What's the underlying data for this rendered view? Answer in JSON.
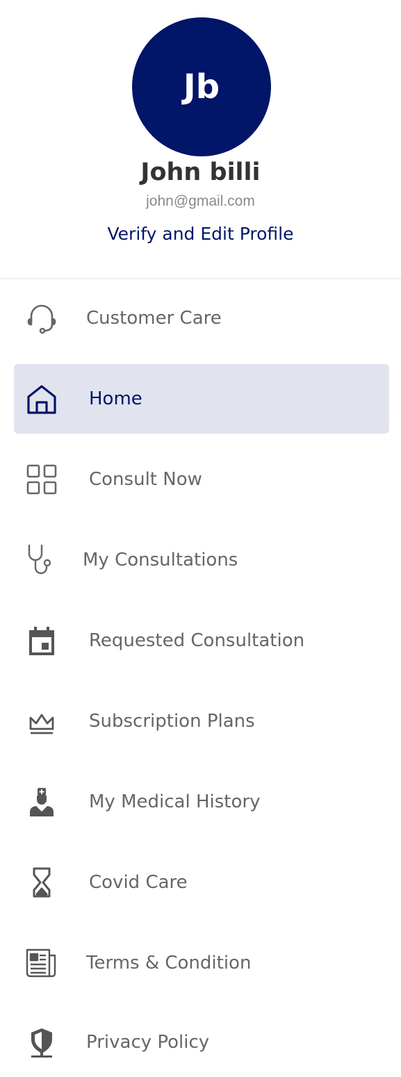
{
  "profile": {
    "initials": "Jb",
    "name": "John billi",
    "email": "john@gmail.com",
    "verify_link": "Verify and Edit Profile"
  },
  "colors": {
    "primary": "#011569",
    "active_bg": "#e1e4ef",
    "text": "#666666"
  },
  "menu": {
    "items": [
      {
        "label": "Customer Care",
        "icon": "headset-icon"
      },
      {
        "label": "Home",
        "icon": "home-icon",
        "active": true
      },
      {
        "label": "Consult Now",
        "icon": "grid-icon"
      },
      {
        "label": "My Consultations",
        "icon": "stethoscope-icon"
      },
      {
        "label": "Requested Consultation",
        "icon": "calendar-icon"
      },
      {
        "label": "Subscription Plans",
        "icon": "crown-icon"
      },
      {
        "label": "My Medical History",
        "icon": "doctor-icon"
      },
      {
        "label": "Covid Care",
        "icon": "hourglass-icon"
      },
      {
        "label": "Terms & Condition",
        "icon": "newspaper-icon"
      },
      {
        "label": "Privacy Policy",
        "icon": "shield-icon"
      }
    ]
  }
}
